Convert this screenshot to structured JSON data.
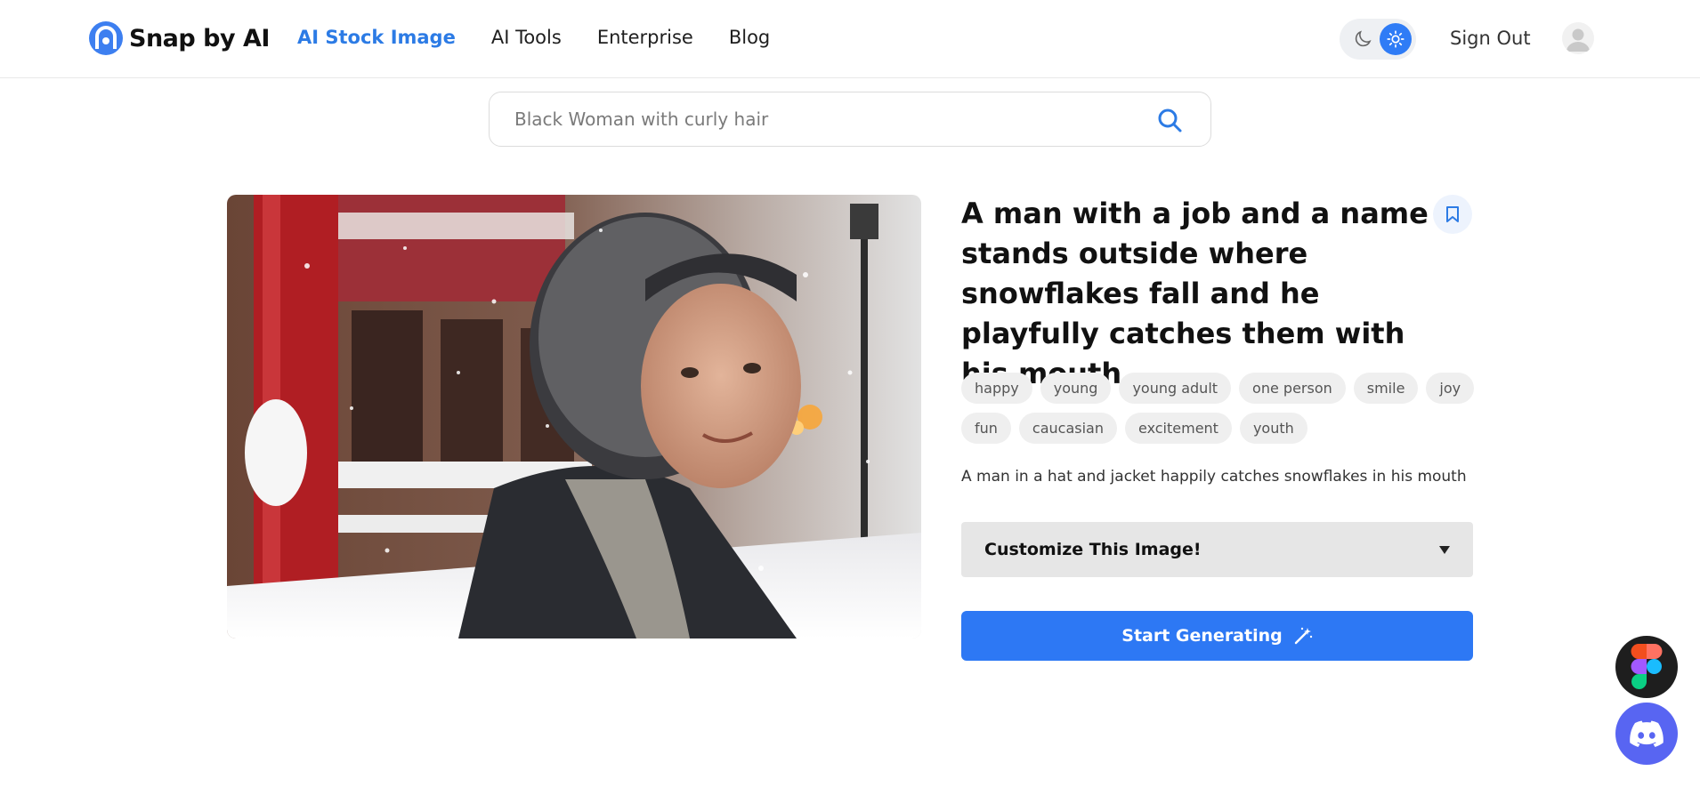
{
  "brand": {
    "name": "Snap by AI",
    "accent": "#2c7be5"
  },
  "nav": {
    "items": [
      {
        "label": "AI Stock Image",
        "active": true
      },
      {
        "label": "AI Tools",
        "active": false
      },
      {
        "label": "Enterprise",
        "active": false
      },
      {
        "label": "Blog",
        "active": false
      }
    ]
  },
  "header": {
    "signout_label": "Sign Out",
    "theme": "light"
  },
  "search": {
    "placeholder": "Black Woman with curly hair",
    "icon": "search-icon"
  },
  "image": {
    "alt": "Man in hooded winter jacket catching snowflakes in a snowy street",
    "title": "A man with a job and a name stands outside where snowflakes fall and he playfully catches them with his mouth",
    "tags": [
      "happy",
      "young",
      "young adult",
      "one person",
      "smile",
      "joy",
      "fun",
      "caucasian",
      "excitement",
      "youth"
    ],
    "description": "A man in a hat and jacket happily catches snowflakes in his mouth"
  },
  "actions": {
    "customize_label": "Customize This Image!",
    "generate_label": "Start Generating"
  },
  "floating": {
    "figma": "figma-icon",
    "discord": "discord-icon"
  }
}
